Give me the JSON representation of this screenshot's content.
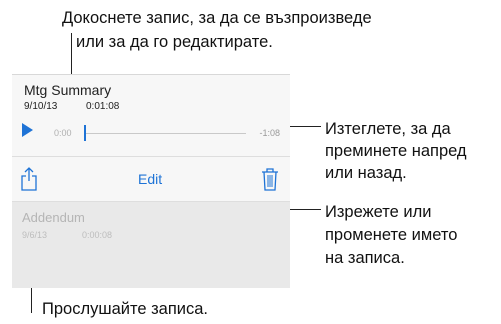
{
  "callouts": {
    "tap_line1": "Докоснете запис, за да се възпроизведе",
    "tap_line2": "или за да го редактирате.",
    "drag_line1": "Изтеглете, за да",
    "drag_line2": "преминете напред",
    "drag_line3": "или назад.",
    "trim_line1": "Изрежете или",
    "trim_line2": "променете името",
    "trim_line3": "на записа.",
    "listen": "Прослушайте записа."
  },
  "recordings": [
    {
      "title": "Mtg Summary",
      "date": "9/10/13",
      "duration": "0:01:08"
    },
    {
      "title": "Addendum",
      "date": "9/6/13",
      "duration": "0:00:08"
    }
  ],
  "player": {
    "elapsed": "0:00",
    "remaining": "-1:08",
    "progress": 0
  },
  "actions": {
    "edit_label": "Edit"
  },
  "colors": {
    "accent": "#1e73d6"
  },
  "icons": {
    "play": "play-icon",
    "share": "share-icon",
    "trash": "trash-icon"
  }
}
